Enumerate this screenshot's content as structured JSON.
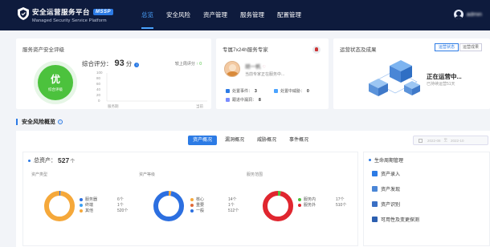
{
  "header": {
    "title": "安全运营服务平台",
    "badge": "MSSP",
    "subtitle": "Managed Security Service Platform",
    "nav": [
      "总览",
      "安全风险",
      "资产管理",
      "服务管理",
      "配置管理"
    ],
    "active_nav": "总览",
    "user_name": "admin"
  },
  "score_card": {
    "title": "服务资产安全评级",
    "grade": "优",
    "grade_label": "综合评级",
    "score_label": "综合评分：",
    "score": "93",
    "score_unit": "分",
    "last_week": "较上周评分",
    "change": "↑ 0",
    "chart": {
      "y_ticks": [
        "100",
        "80",
        "60",
        "40",
        "20",
        "0"
      ],
      "x_start": "服务期",
      "x_end": "当前"
    }
  },
  "expert_card": {
    "title": "专属7x24h服务专家",
    "name": "胡一帆",
    "location": "当前专家正在服务中...",
    "stats": [
      {
        "label": "处置事件：",
        "value": "3"
      },
      {
        "label": "处置中威胁：",
        "value": "0"
      },
      {
        "label": "跟进中漏洞：",
        "value": "8"
      }
    ]
  },
  "ops_card": {
    "title": "运营状态及成果",
    "tab1": "运营状态",
    "tab2": "运营成果",
    "status": "正在运营中...",
    "sub": "已持续运营51天"
  },
  "section": {
    "title": "安全风险概览"
  },
  "overview": {
    "tabs": [
      "资产概况",
      "漏洞概况",
      "威胁概况",
      "事件概况"
    ],
    "date_start": "2022-08",
    "date_sep": "至",
    "date_end": "2022-10",
    "total_label": "总资产：",
    "total_value": "527",
    "total_unit": "个",
    "groups": [
      {
        "title": "资产类型",
        "items": [
          {
            "name": "服务器",
            "value": "6个",
            "color": "#2c6fe0"
          },
          {
            "name": "终端",
            "value": "1个",
            "color": "#3aa0f5"
          },
          {
            "name": "其他",
            "value": "520个",
            "color": "#f5a83a"
          }
        ]
      },
      {
        "title": "资产等级",
        "items": [
          {
            "name": "核心",
            "value": "14个",
            "color": "#f5a83a"
          },
          {
            "name": "重要",
            "value": "1个",
            "color": "#e06a3a"
          },
          {
            "name": "一般",
            "value": "512个",
            "color": "#2c6fe0"
          }
        ]
      },
      {
        "title": "服务范围",
        "items": [
          {
            "name": "服务内",
            "value": "17个",
            "color": "#4cc23d"
          },
          {
            "name": "服务外",
            "value": "510个",
            "color": "#e0262f"
          }
        ]
      }
    ]
  },
  "lifecycle": {
    "title": "生命周期管理",
    "items": [
      "资产录入",
      "资产发现",
      "资产识别",
      "可用性及变更探测"
    ]
  }
}
